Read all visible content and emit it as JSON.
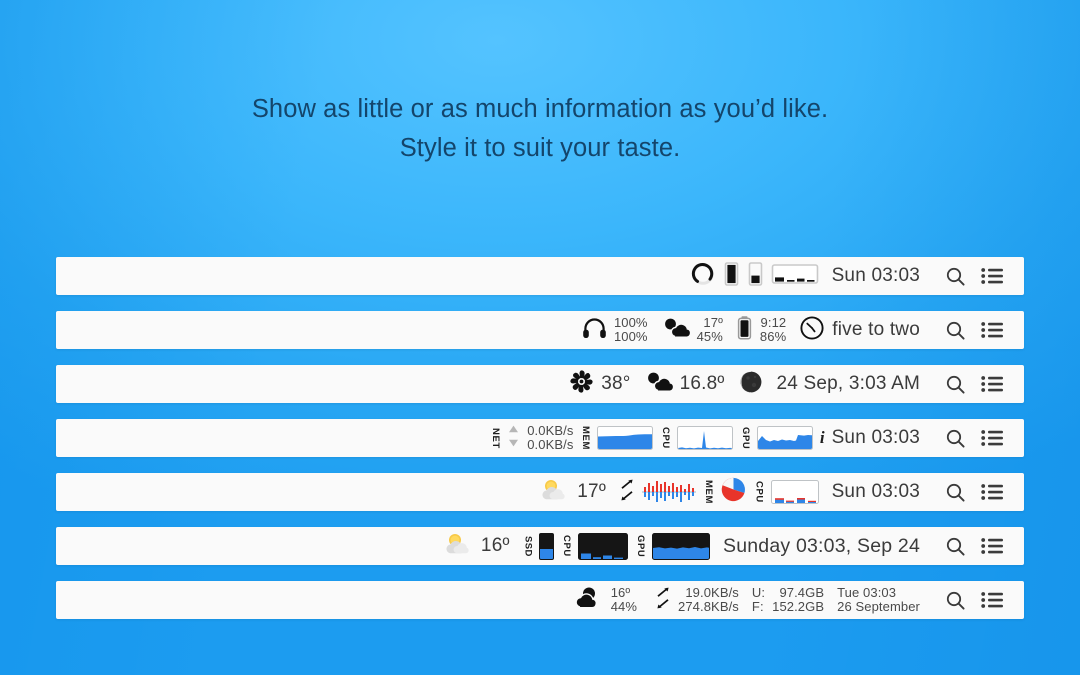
{
  "headline": {
    "line1": "Show as little or as much information as you’d like.",
    "line2": "Style it to suit your taste."
  },
  "colors": {
    "background_top": "#4dc0ff",
    "background_bottom": "#1896ee",
    "bar_background": "#fafafa",
    "text": "#3b3b3b",
    "headline_text": "#14456b",
    "accent_blue": "#2e86e8",
    "accent_red": "#e8342a",
    "graph_dark": "#151515"
  },
  "tools": {
    "search_icon": "search-icon",
    "menu_icon": "menu-list-icon"
  },
  "bars": [
    {
      "id": "bar-1",
      "items": [
        {
          "type": "icon",
          "name": "ring-gauge-icon"
        },
        {
          "type": "icon",
          "name": "vertical-bar-full-icon"
        },
        {
          "type": "icon",
          "name": "vertical-bar-partial-icon"
        },
        {
          "type": "icon",
          "name": "mini-bar-chart-icon"
        }
      ],
      "clock": "Sun 03:03"
    },
    {
      "id": "bar-2",
      "items": [
        {
          "type": "icon",
          "name": "headphones-icon",
          "top": "100%",
          "bottom": "100%"
        },
        {
          "type": "icon",
          "name": "weather-cloud-sun-icon",
          "top": "17º",
          "bottom": "45%"
        },
        {
          "type": "icon",
          "name": "battery-icon",
          "top": "9:12",
          "bottom": "86%"
        },
        {
          "type": "icon",
          "name": "analog-clock-icon"
        }
      ],
      "clock": "five to two"
    },
    {
      "id": "bar-3",
      "items": [
        {
          "type": "icon",
          "name": "fan-icon",
          "value": "38°"
        },
        {
          "type": "icon",
          "name": "weather-cloud-sun-icon",
          "value": "16.8º"
        },
        {
          "type": "icon",
          "name": "moon-phase-icon"
        }
      ],
      "clock": "24 Sep, 3:03 AM"
    },
    {
      "id": "bar-4",
      "items": [
        {
          "type": "label",
          "name": "net-label",
          "text": "NET"
        },
        {
          "type": "icon",
          "name": "net-arrows-updown-icon"
        },
        {
          "type": "stack",
          "name": "net-speed",
          "top": "0.0KB/s",
          "bottom": "0.0KB/s"
        },
        {
          "type": "label",
          "name": "mem-label",
          "text": "MEM"
        },
        {
          "type": "graph",
          "name": "mem-graph"
        },
        {
          "type": "label",
          "name": "cpu-label",
          "text": "CPU"
        },
        {
          "type": "graph",
          "name": "cpu-graph"
        },
        {
          "type": "label",
          "name": "gpu-label",
          "text": "GPU"
        },
        {
          "type": "graph",
          "name": "gpu-graph"
        },
        {
          "type": "icon",
          "name": "info-icon",
          "text": "i"
        }
      ],
      "clock": "Sun 03:03"
    },
    {
      "id": "bar-5",
      "items": [
        {
          "type": "icon",
          "name": "weather-sun-behind-cloud-emoji",
          "value": "17º"
        },
        {
          "type": "icon",
          "name": "net-arrows-diagonal-icon"
        },
        {
          "type": "graph",
          "name": "net-graph"
        },
        {
          "type": "label",
          "name": "mem-label",
          "text": "MEM"
        },
        {
          "type": "chart",
          "name": "mem-pie-chart"
        },
        {
          "type": "label",
          "name": "cpu-label",
          "text": "CPU"
        },
        {
          "type": "graph",
          "name": "cpu-bar-graph"
        }
      ],
      "clock": "Sun 03:03"
    },
    {
      "id": "bar-6",
      "items": [
        {
          "type": "icon",
          "name": "weather-sun-behind-cloud-emoji",
          "value": "16º"
        },
        {
          "type": "label",
          "name": "ssd-label",
          "text": "SSD"
        },
        {
          "type": "graph",
          "name": "ssd-gauge"
        },
        {
          "type": "label",
          "name": "cpu-label",
          "text": "CPU"
        },
        {
          "type": "graph",
          "name": "cpu-graph-dark"
        },
        {
          "type": "label",
          "name": "gpu-label",
          "text": "GPU"
        },
        {
          "type": "graph",
          "name": "gpu-graph-dark"
        }
      ],
      "clock": "Sunday 03:03, Sep 24"
    },
    {
      "id": "bar-7",
      "items": [
        {
          "type": "icon",
          "name": "weather-cloud-icon",
          "top": "16º",
          "bottom": "44%"
        },
        {
          "type": "icon",
          "name": "net-arrows-diagonal-icon",
          "top": "19.0KB/s",
          "bottom": "274.8KB/s"
        },
        {
          "type": "stack",
          "name": "disk-usage-labels",
          "top": "U:",
          "bottom": "F:"
        },
        {
          "type": "stack",
          "name": "disk-usage-values",
          "top": "97.4GB",
          "bottom": "152.2GB"
        },
        {
          "type": "stack",
          "name": "date-stack",
          "top": "Tue 03:03",
          "bottom": "26 September"
        }
      ]
    }
  ]
}
